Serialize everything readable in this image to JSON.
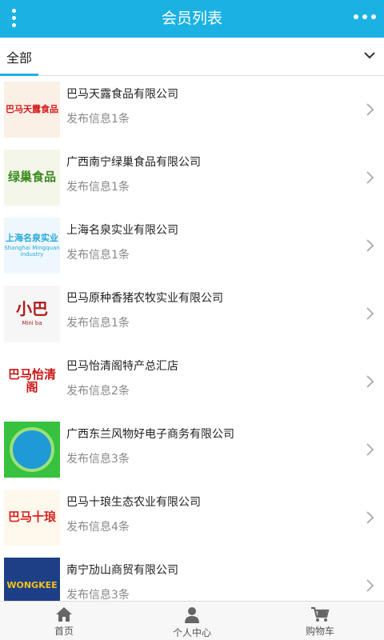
{
  "header": {
    "title": "会员列表",
    "menu_icon": "menu-dots-icon",
    "more_icon": "more-horizontal-icon"
  },
  "filter": {
    "label": "全部",
    "icon": "chevron-down-icon"
  },
  "members": [
    {
      "name": "巴马天露食品有限公司",
      "info": "发布信息1条",
      "logo_text": "巴马天露食品",
      "logo_color": "#d01818",
      "logo_bg": "#fbf0e6"
    },
    {
      "name": "广西南宁绿巢食品有限公司",
      "info": "发布信息1条",
      "logo_text": "绿巢食品",
      "logo_color": "#3a8a1e",
      "logo_bg": "#f4f6ea"
    },
    {
      "name": "上海名泉实业有限公司",
      "info": "发布信息1条",
      "logo_text": "上海名泉实业",
      "logo_sub": "Shanghai Mingquan industry",
      "logo_color": "#2aa6d8",
      "logo_bg": "#eef8fc"
    },
    {
      "name": "巴马原种香猪农牧实业有限公司",
      "info": "发布信息1条",
      "logo_text": "小巴",
      "logo_sub": "Mini ba",
      "logo_color": "#b01b1b",
      "logo_bg": "#f6f6f6"
    },
    {
      "name": "巴马怡清阁特产总汇店",
      "info": "发布信息2条",
      "logo_text": "巴马怡清阁",
      "logo_color": "#c81818",
      "logo_bg": "#fff"
    },
    {
      "name": "广西东兰风物好电子商务有限公司",
      "info": "发布信息3条",
      "logo_text": "",
      "logo_color": "#1c9a2c",
      "logo_bg": "#36c23e"
    },
    {
      "name": "巴马十琅生态农业有限公司",
      "info": "发布信息4条",
      "logo_text": "巴马十琅",
      "logo_color": "#d82222",
      "logo_bg": "#fff8ec"
    },
    {
      "name": "南宁劢山商贸有限公司",
      "info": "发布信息3条",
      "logo_text": "WONGKEE",
      "logo_color": "#f2c21a",
      "logo_bg": "#1d3f86"
    }
  ],
  "tabbar": [
    {
      "label": "首页",
      "icon": "home-icon"
    },
    {
      "label": "个人中心",
      "icon": "user-icon"
    },
    {
      "label": "购物车",
      "icon": "cart-icon"
    }
  ],
  "colors": {
    "accent": "#1bb2e3",
    "text": "#222222",
    "muted": "#888888",
    "divider": "#e3e3e3"
  }
}
